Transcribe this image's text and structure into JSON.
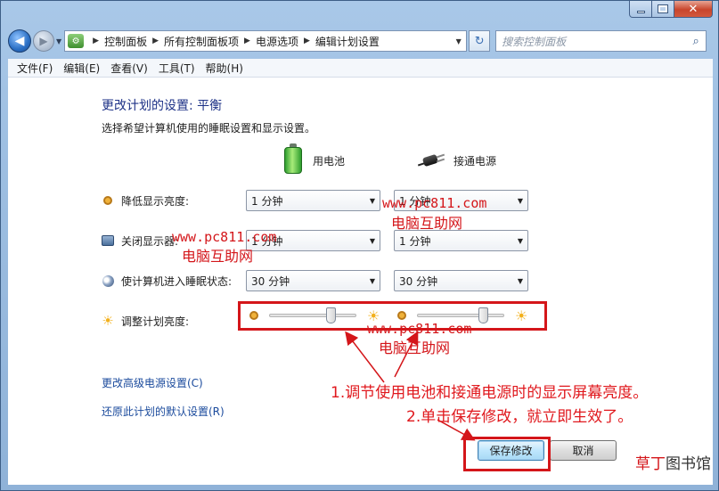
{
  "window": {
    "caption": {
      "minimize": "",
      "maximize": "",
      "close": "✕"
    }
  },
  "nav": {
    "back": "◀",
    "forward": "▶",
    "breadcrumbs": [
      "控制面板",
      "所有控制面板项",
      "电源选项",
      "编辑计划设置"
    ],
    "refresh": "↻",
    "search_placeholder": "搜索控制面板",
    "search_icon": "⌕"
  },
  "menu": [
    "文件(F)",
    "编辑(E)",
    "查看(V)",
    "工具(T)",
    "帮助(H)"
  ],
  "page": {
    "heading": "更改计划的设置: 平衡",
    "subtext": "选择希望计算机使用的睡眠设置和显示设置。",
    "columns": {
      "battery": "用电池",
      "plugged": "接通电源"
    },
    "rows": [
      {
        "label": "降低显示亮度:",
        "battery": "1 分钟",
        "plugged": "1 分钟",
        "icon": "dim-display-icon"
      },
      {
        "label": "关闭显示器:",
        "battery": "1 分钟",
        "plugged": "1 分钟",
        "icon": "monitor-off-icon"
      },
      {
        "label": "使计算机进入睡眠状态:",
        "battery": "30 分钟",
        "plugged": "30 分钟",
        "icon": "sleep-moon-icon"
      }
    ],
    "brightness": {
      "label": "调整计划亮度:",
      "battery_level": 0.72,
      "plugged_level": 0.78
    },
    "links": {
      "advanced": "更改高级电源设置(C)",
      "restore": "还原此计划的默认设置(R)"
    },
    "buttons": {
      "save": "保存修改",
      "cancel": "取消"
    }
  },
  "annotations": {
    "watermark_url": "www.pc811.com",
    "watermark_name": "电脑互助网",
    "note1": "1.调节使用电池和接通电源时的显示屏幕亮度。",
    "note2": "2.单击保存修改，就立即生效了。",
    "corner_red": "草丁",
    "corner_rest": "图书馆"
  },
  "colors": {
    "annotation": "#d4161a",
    "heading": "#1e3287",
    "link": "#1a4a9c"
  }
}
